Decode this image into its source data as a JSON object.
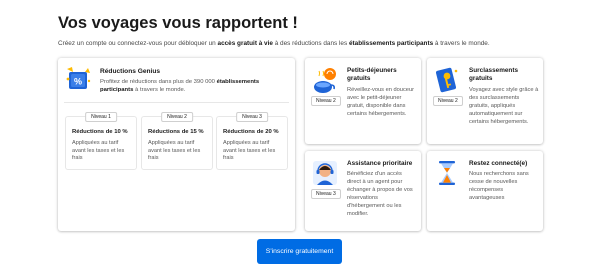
{
  "header": {
    "title": "Vos voyages vous rapportent !",
    "subtitle_pre": "Créez un compte ou connectez-vous pour débloquer un ",
    "subtitle_b1": "accès gratuit à vie",
    "subtitle_mid": " à des réductions dans les ",
    "subtitle_b2": "établissements participants",
    "subtitle_post": " à travers le monde."
  },
  "genius": {
    "title": "Réductions Genius",
    "desc_pre": "Profitez de réductions dans plus de 390 000 ",
    "desc_bold": "établissements participants",
    "desc_post": " à travers le monde.",
    "icon": "genius-percent-icon",
    "levels": [
      {
        "badge": "Niveau 1",
        "title": "Réductions de 10 %",
        "desc": "Appliquées au tarif avant les taxes et les frais"
      },
      {
        "badge": "Niveau 2",
        "title": "Réductions de 15 %",
        "desc": "Appliquées au tarif avant les taxes et les frais"
      },
      {
        "badge": "Niveau 3",
        "title": "Réductions de 20 %",
        "desc": "Appliquées au tarif avant les taxes et les frais"
      }
    ]
  },
  "benefits": {
    "breakfast": {
      "title": "Petits-déjeuners gratuits",
      "desc": "Réveillez-vous en douceur avec le petit-déjeuner gratuit, disponible dans certains hébergements.",
      "level": "Niveau 2",
      "icon": "breakfast-icon"
    },
    "upgrades": {
      "title": "Surclassements gratuits",
      "desc": "Voyagez avec style grâce à des surclassements gratuits, appliqués automatiquement sur certains hébergements.",
      "level": "Niveau 2",
      "icon": "key-icon"
    },
    "assistance": {
      "title": "Assistance prioritaire",
      "desc": "Bénéficiez d'un accès direct à un agent pour échanger à propos de vos réservations d'hébergement ou les modifier.",
      "level": "Niveau 3",
      "icon": "support-agent-icon"
    },
    "stay": {
      "title": "Restez connecté(e)",
      "desc": "Nous recherchons sans cesse de nouvelles récompenses avantageuses",
      "icon": "hourglass-icon"
    }
  },
  "cta": {
    "label": "S'inscrire gratuitement"
  },
  "colors": {
    "primary": "#006ce4",
    "brand_blue": "#1f64d6",
    "accent_yellow": "#febb02"
  }
}
